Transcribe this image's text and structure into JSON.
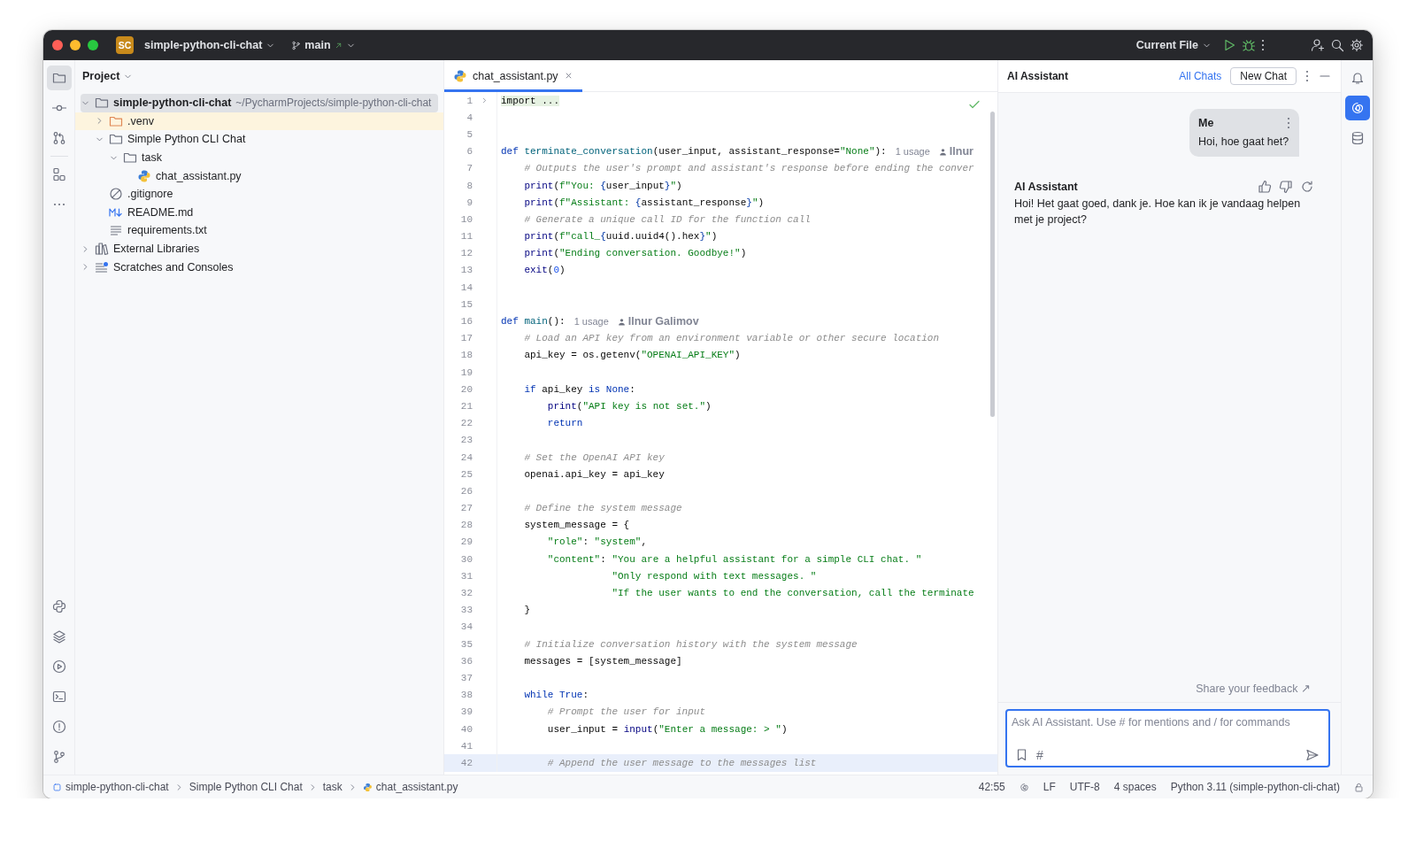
{
  "window": {
    "project_badge": "SC",
    "project": "simple-python-cli-chat",
    "branch": "main",
    "run_config": "Current File"
  },
  "left_toolbar": {
    "top": [
      {
        "kind": "project",
        "selected": true
      },
      {
        "kind": "commit",
        "selected": false
      },
      {
        "kind": "pull_requests",
        "selected": false
      },
      {
        "kind": "structure",
        "selected": false
      },
      {
        "kind": "more",
        "selected": false
      }
    ],
    "bottom": [
      {
        "kind": "python_console",
        "selected": false
      },
      {
        "kind": "packages",
        "selected": false
      },
      {
        "kind": "services",
        "selected": false
      },
      {
        "kind": "terminal",
        "selected": false
      },
      {
        "kind": "problems",
        "selected": false
      },
      {
        "kind": "git",
        "selected": false
      }
    ]
  },
  "project_panel": {
    "title": "Project",
    "tree": [
      {
        "label": "simple-python-cli-chat",
        "path": "~/PycharmProjects/simple-python-cli-chat",
        "kind": "folder",
        "selected": true,
        "highlighted": false,
        "expanded": true,
        "children": [
          {
            "label": ".venv",
            "kind": "folder_excluded",
            "selected": false,
            "highlighted": true,
            "expanded": false
          },
          {
            "label": "Simple Python CLI Chat",
            "kind": "folder",
            "selected": false,
            "highlighted": false,
            "expanded": true,
            "children": [
              {
                "label": "task",
                "kind": "folder",
                "selected": false,
                "highlighted": false,
                "expanded": true,
                "children": [
                  {
                    "label": "chat_assistant.py",
                    "kind": "python",
                    "selected": false,
                    "highlighted": false
                  }
                ]
              }
            ]
          },
          {
            "label": ".gitignore",
            "kind": "ignore",
            "selected": false,
            "highlighted": false
          },
          {
            "label": "README.md",
            "kind": "markdown",
            "selected": false,
            "highlighted": false
          },
          {
            "label": "requirements.txt",
            "kind": "text",
            "selected": false,
            "highlighted": false
          }
        ]
      },
      {
        "label": "External Libraries",
        "kind": "library",
        "selected": false,
        "highlighted": false,
        "expanded": false
      },
      {
        "label": "Scratches and Consoles",
        "kind": "scratches",
        "selected": false,
        "highlighted": false,
        "expanded": false
      }
    ]
  },
  "editor": {
    "tabs": [
      {
        "label": "chat_assistant.py",
        "selected": true
      }
    ],
    "lines": [
      {
        "number": "1",
        "folded": true,
        "current": false,
        "tokens": [
          {
            "kind": "plain",
            "text": "import ..."
          }
        ]
      },
      {
        "number": "4",
        "folded": false,
        "current": false
      },
      {
        "number": "5",
        "folded": false,
        "current": false
      },
      {
        "number": "6",
        "folded": false,
        "current": false,
        "tokens": [
          {
            "kind": "keyword",
            "text": "def "
          },
          {
            "kind": "function",
            "text": "terminate_conversation"
          },
          {
            "kind": "plain",
            "text": "(user_input, assistant_response="
          },
          {
            "kind": "string",
            "text": "\"None\""
          },
          {
            "kind": "plain",
            "text": "):"
          }
        ],
        "hints": [
          {
            "kind": "usages",
            "text": "1 usage"
          },
          {
            "kind": "author",
            "text": "Ilnur"
          }
        ]
      },
      {
        "number": "7",
        "folded": false,
        "current": false,
        "tokens": [
          {
            "kind": "comment",
            "text": "    # Outputs the user's prompt and assistant's response before ending the conver"
          }
        ]
      },
      {
        "number": "8",
        "folded": false,
        "current": false,
        "tokens": [
          {
            "kind": "builtin",
            "text": "    print"
          },
          {
            "kind": "plain",
            "text": "("
          },
          {
            "kind": "string",
            "text": "f\"You: "
          },
          {
            "kind": "brace",
            "text": "{"
          },
          {
            "kind": "plain",
            "text": "user_input"
          },
          {
            "kind": "brace",
            "text": "}"
          },
          {
            "kind": "string",
            "text": "\""
          },
          {
            "kind": "plain",
            "text": ")"
          }
        ]
      },
      {
        "number": "9",
        "folded": false,
        "current": false,
        "tokens": [
          {
            "kind": "builtin",
            "text": "    print"
          },
          {
            "kind": "plain",
            "text": "("
          },
          {
            "kind": "string",
            "text": "f\"Assistant: "
          },
          {
            "kind": "brace",
            "text": "{"
          },
          {
            "kind": "plain",
            "text": "assistant_response"
          },
          {
            "kind": "brace",
            "text": "}"
          },
          {
            "kind": "string",
            "text": "\""
          },
          {
            "kind": "plain",
            "text": ")"
          }
        ]
      },
      {
        "number": "10",
        "folded": false,
        "current": false,
        "tokens": [
          {
            "kind": "comment",
            "text": "    # Generate a unique call ID for the function call"
          }
        ]
      },
      {
        "number": "11",
        "folded": false,
        "current": false,
        "tokens": [
          {
            "kind": "builtin",
            "text": "    print"
          },
          {
            "kind": "plain",
            "text": "("
          },
          {
            "kind": "string",
            "text": "f\"call_"
          },
          {
            "kind": "brace",
            "text": "{"
          },
          {
            "kind": "plain",
            "text": "uuid.uuid4().hex"
          },
          {
            "kind": "brace",
            "text": "}"
          },
          {
            "kind": "string",
            "text": "\""
          },
          {
            "kind": "plain",
            "text": ")"
          }
        ]
      },
      {
        "number": "12",
        "folded": false,
        "current": false,
        "tokens": [
          {
            "kind": "builtin",
            "text": "    print"
          },
          {
            "kind": "plain",
            "text": "("
          },
          {
            "kind": "string",
            "text": "\"Ending conversation. Goodbye!\""
          },
          {
            "kind": "plain",
            "text": ")"
          }
        ]
      },
      {
        "number": "13",
        "folded": false,
        "current": false,
        "tokens": [
          {
            "kind": "builtin",
            "text": "    exit"
          },
          {
            "kind": "plain",
            "text": "("
          },
          {
            "kind": "number",
            "text": "0"
          },
          {
            "kind": "plain",
            "text": ")"
          }
        ]
      },
      {
        "number": "14",
        "folded": false,
        "current": false
      },
      {
        "number": "15",
        "folded": false,
        "current": false
      },
      {
        "number": "16",
        "folded": false,
        "current": false,
        "tokens": [
          {
            "kind": "keyword",
            "text": "def "
          },
          {
            "kind": "function",
            "text": "main"
          },
          {
            "kind": "plain",
            "text": "():"
          }
        ],
        "hints": [
          {
            "kind": "usages",
            "text": "1 usage"
          },
          {
            "kind": "author",
            "text": "Ilnur Galimov"
          }
        ]
      },
      {
        "number": "17",
        "folded": false,
        "current": false,
        "tokens": [
          {
            "kind": "comment",
            "text": "    # Load an API key from an environment variable or other secure location"
          }
        ]
      },
      {
        "number": "18",
        "folded": false,
        "current": false,
        "tokens": [
          {
            "kind": "plain",
            "text": "    api_key = os.getenv("
          },
          {
            "kind": "string",
            "text": "\"OPENAI_API_KEY\""
          },
          {
            "kind": "plain",
            "text": ")"
          }
        ]
      },
      {
        "number": "19",
        "folded": false,
        "current": false
      },
      {
        "number": "20",
        "folded": false,
        "current": false,
        "tokens": [
          {
            "kind": "keyword",
            "text": "    if"
          },
          {
            "kind": "plain",
            "text": " api_key "
          },
          {
            "kind": "keyword",
            "text": "is"
          },
          {
            "kind": "keyword",
            "text": " None"
          },
          {
            "kind": "plain",
            "text": ":"
          }
        ]
      },
      {
        "number": "21",
        "folded": false,
        "current": false,
        "tokens": [
          {
            "kind": "builtin",
            "text": "        print"
          },
          {
            "kind": "plain",
            "text": "("
          },
          {
            "kind": "string",
            "text": "\"API key is not set.\""
          },
          {
            "kind": "plain",
            "text": ")"
          }
        ]
      },
      {
        "number": "22",
        "folded": false,
        "current": false,
        "tokens": [
          {
            "kind": "keyword",
            "text": "        return"
          }
        ]
      },
      {
        "number": "23",
        "folded": false,
        "current": false
      },
      {
        "number": "24",
        "folded": false,
        "current": false,
        "tokens": [
          {
            "kind": "comment",
            "text": "    # Set the OpenAI API key"
          }
        ]
      },
      {
        "number": "25",
        "folded": false,
        "current": false,
        "tokens": [
          {
            "kind": "plain",
            "text": "    openai.api_key = api_key"
          }
        ]
      },
      {
        "number": "26",
        "folded": false,
        "current": false
      },
      {
        "number": "27",
        "folded": false,
        "current": false,
        "tokens": [
          {
            "kind": "comment",
            "text": "    # Define the system message"
          }
        ]
      },
      {
        "number": "28",
        "folded": false,
        "current": false,
        "tokens": [
          {
            "kind": "plain",
            "text": "    system_message = {"
          }
        ]
      },
      {
        "number": "29",
        "folded": false,
        "current": false,
        "tokens": [
          {
            "kind": "string",
            "text": "        \"role\""
          },
          {
            "kind": "plain",
            "text": ": "
          },
          {
            "kind": "string",
            "text": "\"system\""
          },
          {
            "kind": "plain",
            "text": ","
          }
        ]
      },
      {
        "number": "30",
        "folded": false,
        "current": false,
        "tokens": [
          {
            "kind": "string",
            "text": "        \"content\""
          },
          {
            "kind": "plain",
            "text": ": "
          },
          {
            "kind": "string",
            "text": "\"You are a helpful assistant for a simple CLI chat. \""
          }
        ]
      },
      {
        "number": "31",
        "folded": false,
        "current": false,
        "tokens": [
          {
            "kind": "string",
            "text": "                   \"Only respond with text messages. \""
          }
        ]
      },
      {
        "number": "32",
        "folded": false,
        "current": false,
        "tokens": [
          {
            "kind": "string",
            "text": "                   \"If the user wants to end the conversation, call the terminate"
          }
        ]
      },
      {
        "number": "33",
        "folded": false,
        "current": false,
        "tokens": [
          {
            "kind": "plain",
            "text": "    }"
          }
        ]
      },
      {
        "number": "34",
        "folded": false,
        "current": false
      },
      {
        "number": "35",
        "folded": false,
        "current": false,
        "tokens": [
          {
            "kind": "comment",
            "text": "    # Initialize conversation history with the system message"
          }
        ]
      },
      {
        "number": "36",
        "folded": false,
        "current": false,
        "tokens": [
          {
            "kind": "plain",
            "text": "    messages = [system_message]"
          }
        ]
      },
      {
        "number": "37",
        "folded": false,
        "current": false
      },
      {
        "number": "38",
        "folded": false,
        "current": false,
        "tokens": [
          {
            "kind": "keyword",
            "text": "    while"
          },
          {
            "kind": "keyword",
            "text": " True"
          },
          {
            "kind": "plain",
            "text": ":"
          }
        ]
      },
      {
        "number": "39",
        "folded": false,
        "current": false,
        "tokens": [
          {
            "kind": "comment",
            "text": "        # Prompt the user for input"
          }
        ]
      },
      {
        "number": "40",
        "folded": false,
        "current": false,
        "tokens": [
          {
            "kind": "plain",
            "text": "        user_input = "
          },
          {
            "kind": "builtin",
            "text": "input"
          },
          {
            "kind": "plain",
            "text": "("
          },
          {
            "kind": "string",
            "text": "\"Enter a message: > \""
          },
          {
            "kind": "plain",
            "text": ")"
          }
        ]
      },
      {
        "number": "41",
        "folded": false,
        "current": false
      },
      {
        "number": "42",
        "folded": false,
        "current": true,
        "tokens": [
          {
            "kind": "comment",
            "text": "        # Append the user message to the messages list"
          }
        ]
      }
    ]
  },
  "ai_panel": {
    "title": "AI Assistant",
    "all_chats": "All Chats",
    "new_chat": "New Chat",
    "messages": [
      {
        "kind": "user",
        "author": "Me",
        "text": "Hoi, hoe gaat het?"
      },
      {
        "kind": "assistant",
        "author": "AI Assistant",
        "text": "Hoi! Het gaat goed, dank je. Hoe kan ik je vandaag helpen met je project?"
      }
    ],
    "feedback": "Share your feedback ↗",
    "input": {
      "placeholder": "Ask AI Assistant. Use # for mentions and / for commands",
      "mention": "#"
    }
  },
  "right_toolbar": [
    {
      "kind": "notifications",
      "selected": false
    },
    {
      "kind": "ai_assistant",
      "selected": true
    },
    {
      "kind": "database",
      "selected": false
    }
  ],
  "status_bar": {
    "breadcrumbs": [
      {
        "kind": "module",
        "text": "simple-python-cli-chat"
      },
      {
        "kind": "folder",
        "text": "Simple Python CLI Chat"
      },
      {
        "kind": "folder",
        "text": "task"
      },
      {
        "kind": "python",
        "text": "chat_assistant.py"
      }
    ],
    "position": "42:55",
    "line_ending": "LF",
    "encoding": "UTF-8",
    "indent": "4 spaces",
    "interpreter": "Python 3.11 (simple-python-cli-chat)"
  }
}
